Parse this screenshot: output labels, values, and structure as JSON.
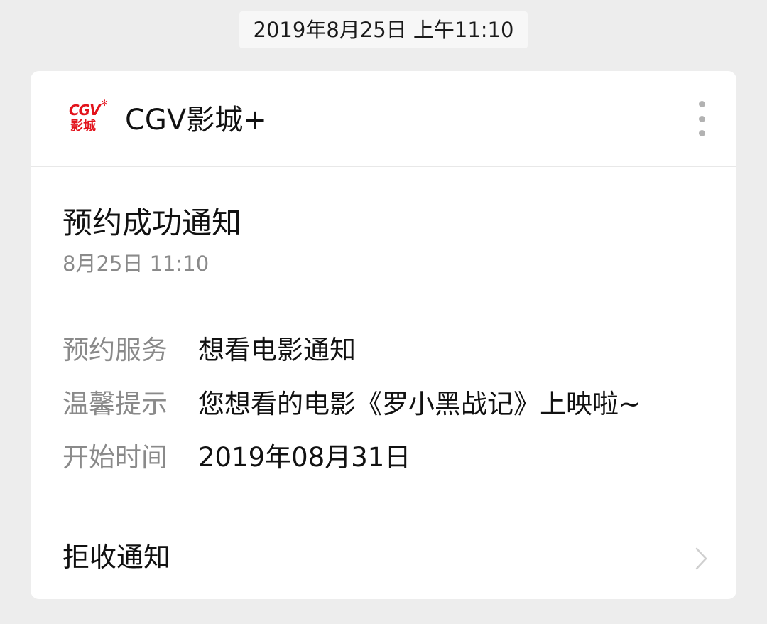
{
  "chat": {
    "timestamp": "2019年8月25日 上午11:10"
  },
  "card": {
    "logo": {
      "brand_top": "CGV",
      "brand_bottom": "影城",
      "icon": "cgv-logo",
      "color": "#e3131c"
    },
    "account_name": "CGV影城+",
    "more_icon": "more-vertical-icon",
    "title": "预约成功通知",
    "time": "8月25日  11:10",
    "fields": [
      {
        "label": "预约服务",
        "value": "想看电影通知"
      },
      {
        "label": "温馨提示",
        "value": "您想看的电影《罗小黑战记》上映啦~"
      },
      {
        "label": "开始时间",
        "value": "2019年08月31日"
      }
    ],
    "footer": {
      "label": "拒收通知",
      "icon": "chevron-right-icon"
    }
  }
}
